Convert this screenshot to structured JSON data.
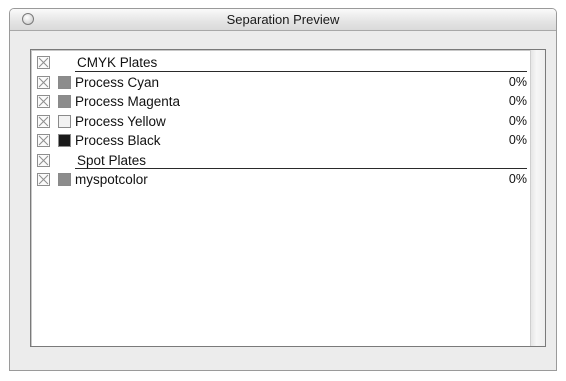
{
  "window": {
    "title": "Separation Preview"
  },
  "icons": {
    "close": "close-icon",
    "checkbox": "checkbox-x-icon"
  },
  "plates": [
    {
      "kind": "header",
      "label": "CMYK Plates",
      "checked": false
    },
    {
      "kind": "plate",
      "label": "Process Cyan",
      "swatch": "#8c8c8c",
      "percent": "0%",
      "checked": false
    },
    {
      "kind": "plate",
      "label": "Process Magenta",
      "swatch": "#8c8c8c",
      "percent": "0%",
      "checked": false
    },
    {
      "kind": "plate",
      "label": "Process Yellow",
      "swatch": "#f2f2f2",
      "percent": "0%",
      "checked": false
    },
    {
      "kind": "plate",
      "label": "Process Black",
      "swatch": "#1a1a1a",
      "percent": "0%",
      "checked": false
    },
    {
      "kind": "header",
      "label": "Spot Plates",
      "checked": false
    },
    {
      "kind": "plate",
      "label": "myspotcolor",
      "swatch": "#8c8c8c",
      "percent": "0%",
      "checked": false
    }
  ]
}
